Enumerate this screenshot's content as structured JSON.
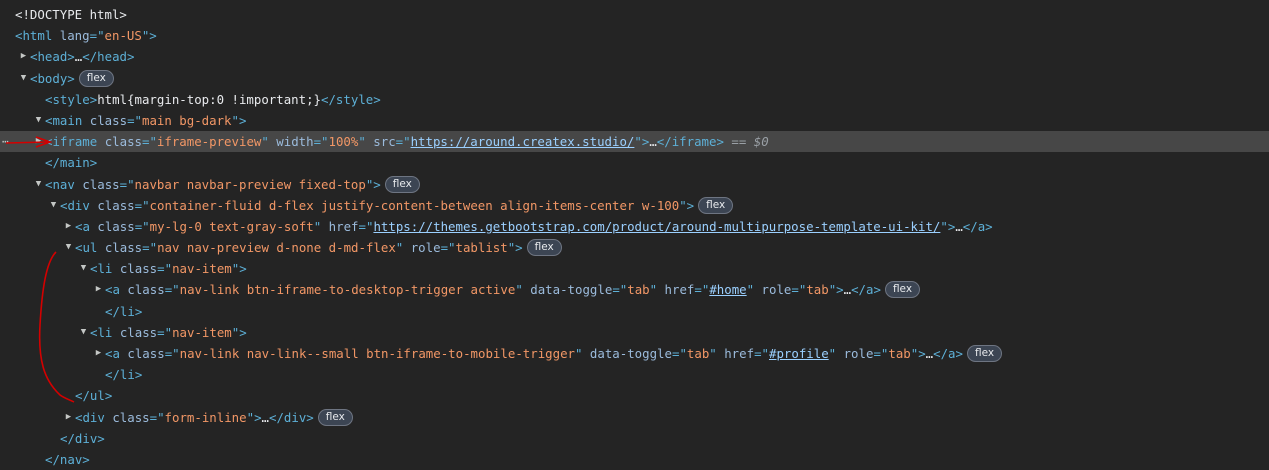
{
  "rows": [
    {
      "parts": [
        [
          "txt",
          "<!DOCTYPE html>"
        ]
      ]
    },
    {
      "parts": [
        [
          "tag",
          "<html "
        ],
        [
          "attr",
          "lang"
        ],
        [
          "tag",
          "=\""
        ],
        [
          "val",
          "en-US"
        ],
        [
          "tag",
          "\">"
        ]
      ]
    },
    {
      "parts": [
        [
          "tag",
          "<head>"
        ],
        [
          "txt",
          "…"
        ],
        [
          "tag",
          "</head>"
        ]
      ]
    },
    {
      "parts": [
        [
          "tag",
          "<body>"
        ]
      ],
      "badge": "flex"
    },
    {
      "parts": [
        [
          "tag",
          "<style>"
        ],
        [
          "txt",
          "html{margin-top:0 !important;}"
        ],
        [
          "tag",
          "</style>"
        ]
      ]
    },
    {
      "parts": [
        [
          "tag",
          "<main "
        ],
        [
          "attr",
          "class"
        ],
        [
          "tag",
          "=\""
        ],
        [
          "val",
          "main bg-dark"
        ],
        [
          "tag",
          "\">"
        ]
      ]
    },
    {
      "parts": [
        [
          "tag",
          "<iframe "
        ],
        [
          "attr",
          "class"
        ],
        [
          "tag",
          "=\""
        ],
        [
          "val",
          "iframe-preview"
        ],
        [
          "tag",
          "\" "
        ],
        [
          "attr",
          "width"
        ],
        [
          "tag",
          "=\""
        ],
        [
          "val",
          "100%"
        ],
        [
          "tag",
          "\" "
        ],
        [
          "attr",
          "src"
        ],
        [
          "tag",
          "=\""
        ],
        [
          "link",
          "https://around.createx.studio/"
        ],
        [
          "tag",
          "\">"
        ],
        [
          "txt",
          "…"
        ],
        [
          "tag",
          "</iframe>"
        ]
      ],
      "suffix": " == $0"
    },
    {
      "parts": [
        [
          "tag",
          "</main>"
        ]
      ]
    },
    {
      "parts": [
        [
          "tag",
          "<nav "
        ],
        [
          "attr",
          "class"
        ],
        [
          "tag",
          "=\""
        ],
        [
          "val",
          "navbar navbar-preview fixed-top"
        ],
        [
          "tag",
          "\">"
        ]
      ],
      "badge": "flex"
    },
    {
      "parts": [
        [
          "tag",
          "<div "
        ],
        [
          "attr",
          "class"
        ],
        [
          "tag",
          "=\""
        ],
        [
          "val",
          "container-fluid d-flex justify-content-between align-items-center w-100"
        ],
        [
          "tag",
          "\">"
        ]
      ],
      "badge": "flex"
    },
    {
      "parts": [
        [
          "tag",
          "<a "
        ],
        [
          "attr",
          "class"
        ],
        [
          "tag",
          "=\""
        ],
        [
          "val",
          "my-lg-0 text-gray-soft"
        ],
        [
          "tag",
          "\" "
        ],
        [
          "attr",
          "href"
        ],
        [
          "tag",
          "=\""
        ],
        [
          "link",
          "https://themes.getbootstrap.com/product/around-multipurpose-template-ui-kit/"
        ],
        [
          "tag",
          "\">"
        ],
        [
          "txt",
          "…"
        ],
        [
          "tag",
          "</a>"
        ]
      ]
    },
    {
      "parts": [
        [
          "tag",
          "<ul "
        ],
        [
          "attr",
          "class"
        ],
        [
          "tag",
          "=\""
        ],
        [
          "val",
          "nav nav-preview d-none d-md-flex"
        ],
        [
          "tag",
          "\" "
        ],
        [
          "attr",
          "role"
        ],
        [
          "tag",
          "=\""
        ],
        [
          "val",
          "tablist"
        ],
        [
          "tag",
          "\">"
        ]
      ],
      "badge": "flex"
    },
    {
      "parts": [
        [
          "tag",
          "<li "
        ],
        [
          "attr",
          "class"
        ],
        [
          "tag",
          "=\""
        ],
        [
          "val",
          "nav-item"
        ],
        [
          "tag",
          "\">"
        ]
      ]
    },
    {
      "parts": [
        [
          "tag",
          "<a "
        ],
        [
          "attr",
          "class"
        ],
        [
          "tag",
          "=\""
        ],
        [
          "val",
          "nav-link btn-iframe-to-desktop-trigger active"
        ],
        [
          "tag",
          "\" "
        ],
        [
          "attr",
          "data-toggle"
        ],
        [
          "tag",
          "=\""
        ],
        [
          "val",
          "tab"
        ],
        [
          "tag",
          "\" "
        ],
        [
          "attr",
          "href"
        ],
        [
          "tag",
          "=\""
        ],
        [
          "link",
          "#home"
        ],
        [
          "tag",
          "\" "
        ],
        [
          "attr",
          "role"
        ],
        [
          "tag",
          "=\""
        ],
        [
          "val",
          "tab"
        ],
        [
          "tag",
          "\">"
        ],
        [
          "txt",
          "…"
        ],
        [
          "tag",
          "</a>"
        ]
      ],
      "badge": "flex"
    },
    {
      "parts": [
        [
          "tag",
          "</li>"
        ]
      ]
    },
    {
      "parts": [
        [
          "tag",
          "<li "
        ],
        [
          "attr",
          "class"
        ],
        [
          "tag",
          "=\""
        ],
        [
          "val",
          "nav-item"
        ],
        [
          "tag",
          "\">"
        ]
      ]
    },
    {
      "parts": [
        [
          "tag",
          "<a "
        ],
        [
          "attr",
          "class"
        ],
        [
          "tag",
          "=\""
        ],
        [
          "val",
          "nav-link nav-link--small btn-iframe-to-mobile-trigger"
        ],
        [
          "tag",
          "\" "
        ],
        [
          "attr",
          "data-toggle"
        ],
        [
          "tag",
          "=\""
        ],
        [
          "val",
          "tab"
        ],
        [
          "tag",
          "\" "
        ],
        [
          "attr",
          "href"
        ],
        [
          "tag",
          "=\""
        ],
        [
          "link",
          "#profile"
        ],
        [
          "tag",
          "\" "
        ],
        [
          "attr",
          "role"
        ],
        [
          "tag",
          "=\""
        ],
        [
          "val",
          "tab"
        ],
        [
          "tag",
          "\">"
        ],
        [
          "txt",
          "…"
        ],
        [
          "tag",
          "</a>"
        ]
      ],
      "badge": "flex"
    },
    {
      "parts": [
        [
          "tag",
          "</li>"
        ]
      ]
    },
    {
      "parts": [
        [
          "tag",
          "</ul>"
        ]
      ]
    },
    {
      "parts": [
        [
          "tag",
          "<div "
        ],
        [
          "attr",
          "class"
        ],
        [
          "tag",
          "=\""
        ],
        [
          "val",
          "form-inline"
        ],
        [
          "tag",
          "\">"
        ],
        [
          "txt",
          "…"
        ],
        [
          "tag",
          "</div>"
        ]
      ],
      "badge": "flex"
    },
    {
      "parts": [
        [
          "tag",
          "</div>"
        ]
      ]
    },
    {
      "parts": [
        [
          "tag",
          "</nav>"
        ]
      ]
    }
  ],
  "colors": {
    "background": "#242424",
    "selected": "#474747",
    "annotation": "#d40000"
  }
}
